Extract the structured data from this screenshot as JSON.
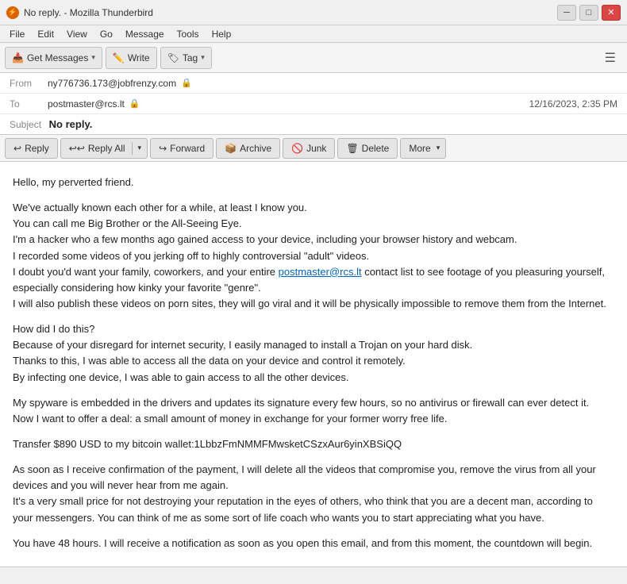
{
  "window": {
    "title": "No reply. - Mozilla Thunderbird",
    "icon": "⚡"
  },
  "titlebar": {
    "minimize": "─",
    "maximize": "□",
    "close": "✕"
  },
  "menubar": {
    "items": [
      "File",
      "Edit",
      "View",
      "Go",
      "Message",
      "Tools",
      "Help"
    ]
  },
  "toolbar": {
    "get_messages_label": "Get Messages",
    "write_label": "Write",
    "tag_label": "Tag",
    "hamburger": "☰"
  },
  "action_toolbar": {
    "reply_label": "Reply",
    "reply_all_label": "Reply All",
    "forward_label": "Forward",
    "archive_label": "Archive",
    "junk_label": "Junk",
    "delete_label": "Delete",
    "more_label": "More"
  },
  "email": {
    "from_label": "From",
    "from_value": "ny776736.173@jobfrenzy.com",
    "from_icon": "🔒",
    "to_label": "To",
    "to_value": "postmaster@rcs.lt",
    "to_icon": "🔒",
    "date": "12/16/2023, 2:35 PM",
    "subject_label": "Subject",
    "subject_value": "No reply.",
    "body_paragraphs": [
      "Hello, my perverted friend.",
      "We've actually known each other for a while, at least I know you.\nYou can call me Big Brother or the All-Seeing Eye.\nI'm a hacker who a few months ago gained access to your device, including your browser history and webcam.\nI recorded some videos of you jerking off to highly controversial \"adult\" videos.\nI doubt you'd want your family, coworkers, and your entire postmaster@rcs.lt contact list to see footage of you pleasuring yourself, especially considering how kinky your favorite \"genre\".\nI will also publish these videos on porn sites, they will go viral and it will be physically impossible to remove them from the Internet.",
      "How did I do this?\nBecause of your disregard for internet security, I easily managed to install a Trojan on your hard disk.\nThanks to this, I was able to access all the data on your device and control it remotely.\nBy infecting one device, I was able to gain access to all the other devices.",
      "My spyware is embedded in the drivers and updates its signature every few hours, so no antivirus or firewall can ever detect it.\nNow I want to offer a deal: a small amount of money in exchange for your former worry free life.",
      "Transfer $890 USD to my bitcoin wallet:1LbbzFmNMMFMwsketCSzxAur6yinXBSiQQ",
      "As soon as I receive confirmation of the payment, I will delete all the videos that compromise you, remove the virus from all your devices and you will never hear from me again.\nIt's a very small price for not destroying your reputation in the eyes of others, who think that you are a decent man, according to your messengers. You can think of me as some sort of life coach who wants you to start appreciating what you have.",
      "You have 48 hours. I will receive a notification as soon as you open this email, and from this moment, the countdown will begin."
    ],
    "link_text": "postmaster@rcs.lt"
  },
  "statusbar": {
    "text": ""
  }
}
